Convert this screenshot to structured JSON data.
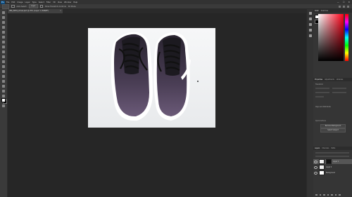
{
  "app": {
    "logo": "Ps",
    "menu": [
      "File",
      "Edit",
      "Image",
      "Layer",
      "Type",
      "Select",
      "Filter",
      "3D",
      "View",
      "Window",
      "Help"
    ],
    "window_controls": [
      "—",
      "☐",
      "✕"
    ]
  },
  "options_bar": {
    "auto_select_label": "Auto-Select:",
    "auto_select_value": "Layer",
    "show_transform_label": "Show Transform Controls",
    "mode_label": "3D Mode:"
  },
  "document": {
    "tab_title": "IMG_8034_shoes.psd @ 25% (Layer 1, RGB/8*)",
    "close_symbol": "×"
  },
  "panels": {
    "color_tabs": [
      "Color",
      "Swatches"
    ],
    "properties_tabs": [
      "Properties",
      "Adjustments",
      "Libraries"
    ],
    "properties_section": "Transform",
    "align_section": "Align and Distribute",
    "quick_actions": "Quick Actions",
    "remove_bg_label": "Remove Background",
    "select_subject_label": "Select Subject",
    "layers_tabs": [
      "Layers",
      "Channels",
      "Paths"
    ],
    "layers": [
      {
        "name": "Layer 1",
        "selected": true
      },
      {
        "name": "Layer 0",
        "selected": false
      },
      {
        "name": "Background",
        "selected": false
      }
    ]
  },
  "colors": {
    "foreground": "#ffffff",
    "background": "#000000",
    "shoe_leather": "#4a3e55",
    "sole": "#ffffff"
  }
}
